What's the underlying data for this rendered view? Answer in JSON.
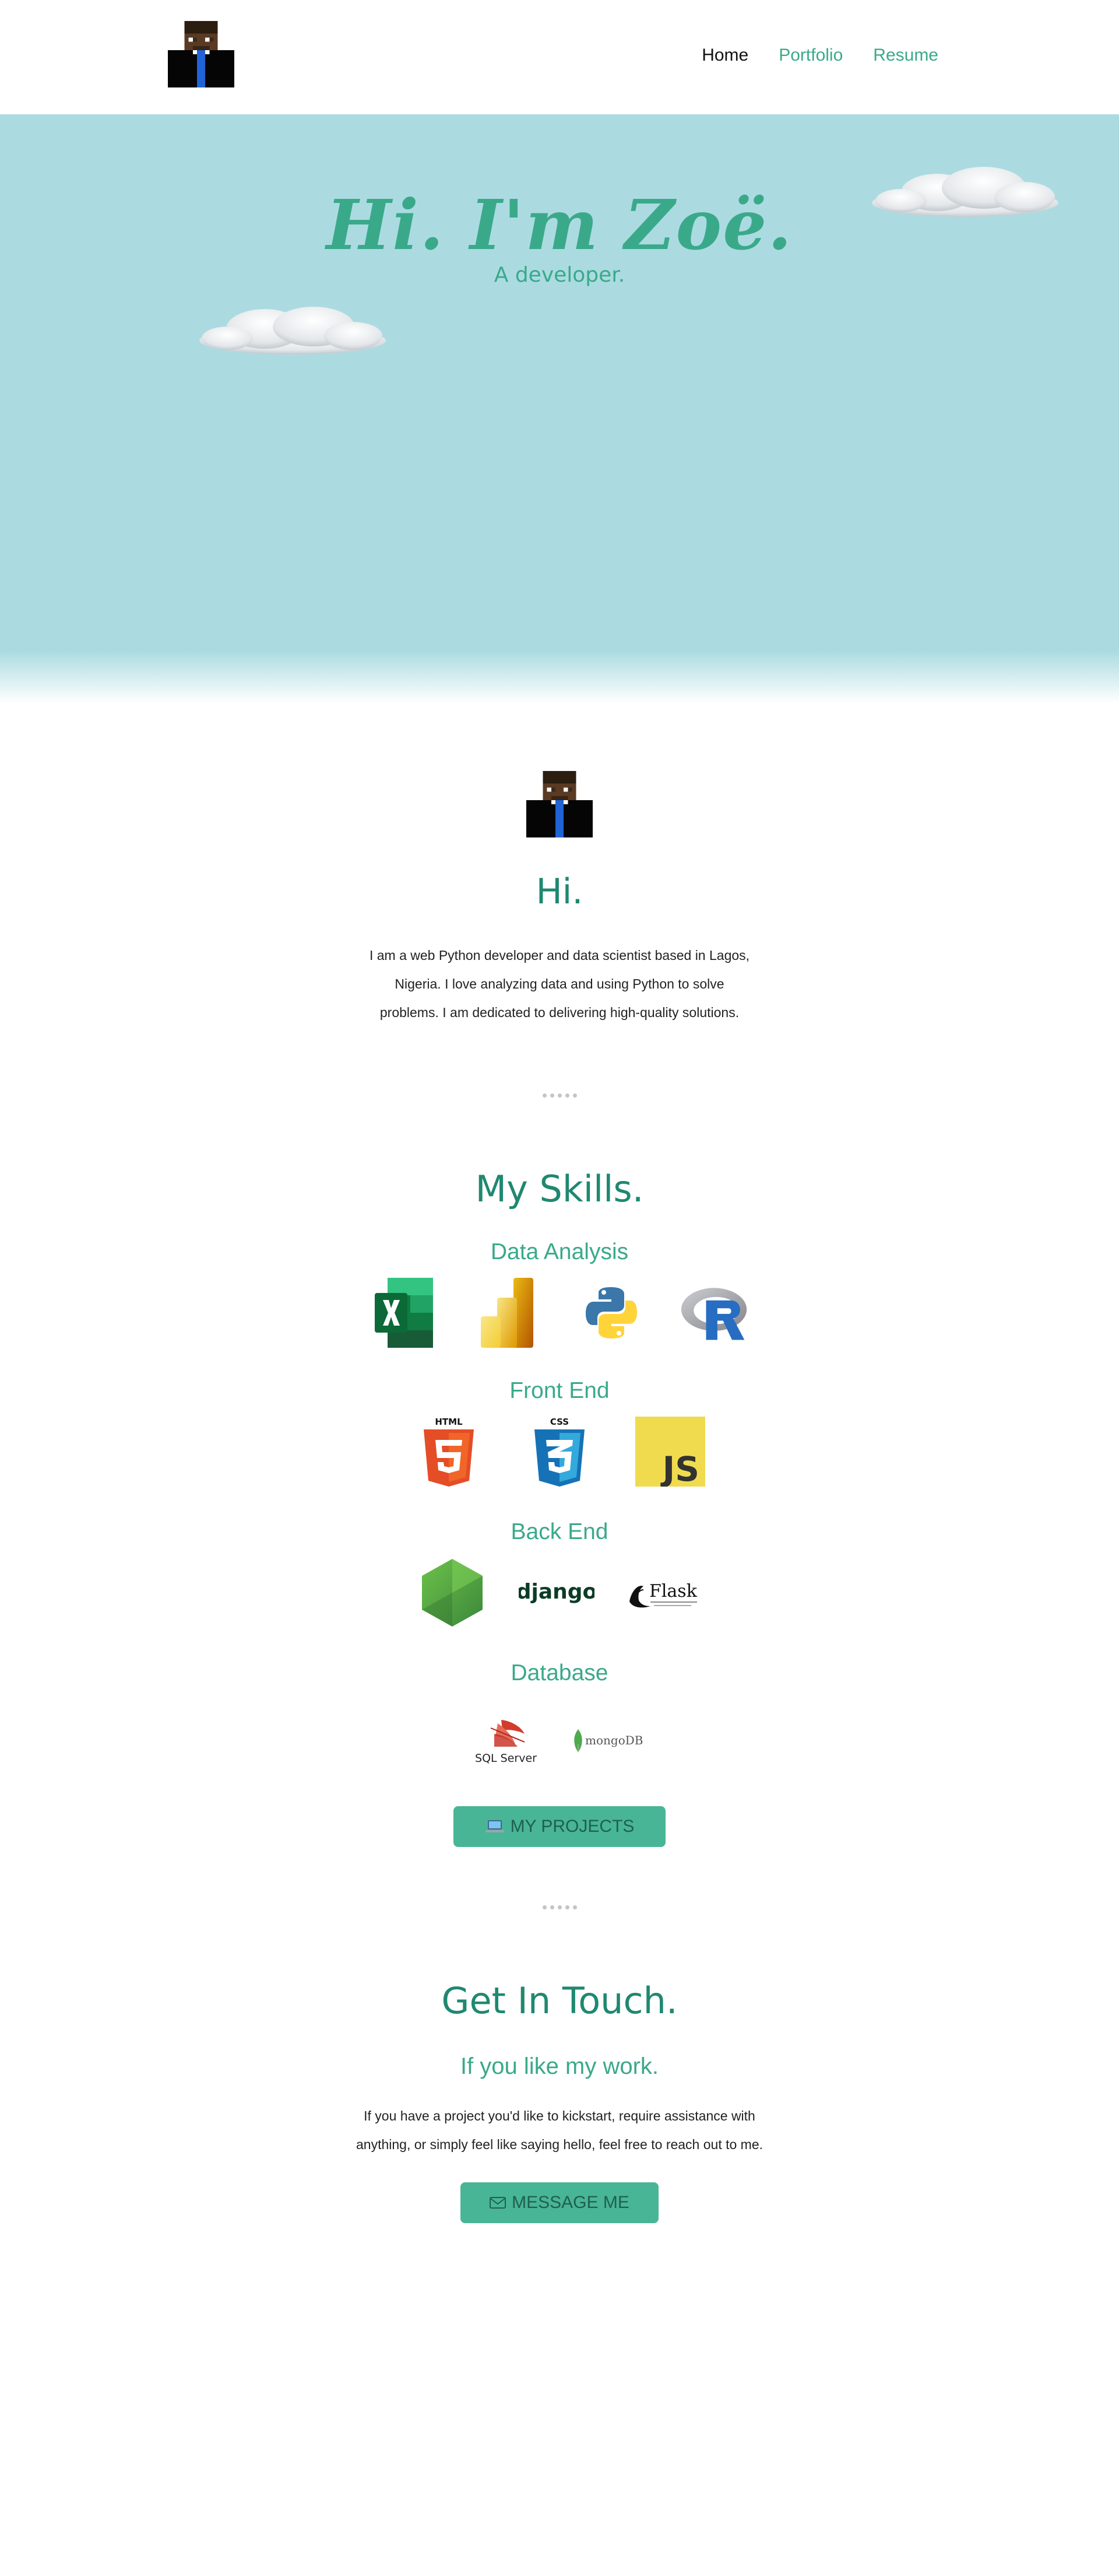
{
  "nav": {
    "logo_alt": "avatar",
    "links": [
      {
        "label": "Home",
        "active": true
      },
      {
        "label": "Portfolio",
        "active": false
      },
      {
        "label": "Resume",
        "active": false
      }
    ]
  },
  "hero": {
    "title": "Hi. I'm Zoë.",
    "subtitle": "A developer."
  },
  "about": {
    "heading": "Hi.",
    "text": "I am a web Python developer and data scientist based in Lagos, Nigeria. I love analyzing data and using Python to solve problems. I am dedicated to delivering high-quality solutions."
  },
  "skills": {
    "heading": "My Skills.",
    "groups": [
      {
        "title": "Data Analysis",
        "icons": [
          "excel-icon",
          "power-bi-icon",
          "python-icon",
          "r-icon"
        ]
      },
      {
        "title": "Front End",
        "icons": [
          "html5-icon",
          "css3-icon",
          "javascript-icon"
        ]
      },
      {
        "title": "Back End",
        "icons": [
          "nodejs-icon",
          "django-icon",
          "flask-icon"
        ]
      },
      {
        "title": "Database",
        "icons": [
          "sql-server-icon",
          "mongodb-icon"
        ]
      }
    ],
    "icon_text": {
      "html": "HTML",
      "css": "CSS",
      "js": "JS",
      "django": "django",
      "flask": "Flask",
      "sql_server": "SQL Server",
      "mongodb": "mongoDB"
    },
    "projects_button": "MY PROJECTS"
  },
  "contact": {
    "heading": "Get In Touch.",
    "subheading": "If you like my work.",
    "text": "If you have a project you'd like to kickstart, require assistance with anything, or simply feel like saying hello, feel free to reach out to me.",
    "button": "MESSAGE ME"
  },
  "colors": {
    "accent": "#3aa98a",
    "accent_dark": "#1f8870",
    "button_bg": "#48b596",
    "sky": "#abdbe1"
  }
}
